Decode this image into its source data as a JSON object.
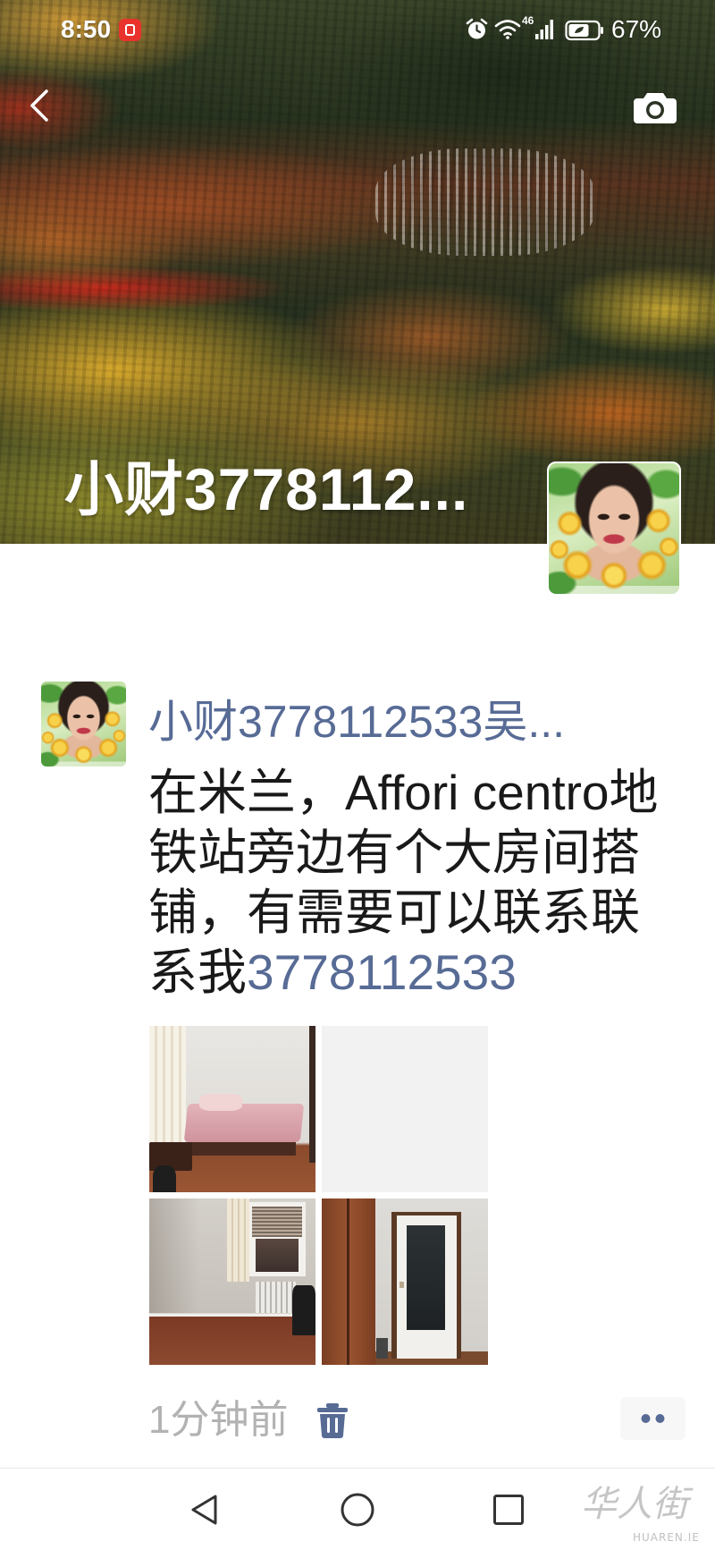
{
  "status_bar": {
    "time": "8:50",
    "network_type": "46",
    "battery": "67%"
  },
  "cover": {
    "name": "小财3778112..."
  },
  "post": {
    "author": "小财3778112533吴...",
    "text": "在米兰，Affori centro地铁站旁边有个大房间搭铺，有需要可以联系联系我",
    "phone": "3778112533",
    "time": "1分钟前"
  },
  "watermark": {
    "logo": "华人街",
    "site": "HUAREN.IE"
  },
  "icons": {
    "back": "chevron-left-icon",
    "camera": "camera-icon",
    "notification": "notification-badge-icon",
    "alarm": "alarm-icon",
    "wifi": "wifi-icon",
    "signal": "signal-icon",
    "battery": "battery-icon",
    "delete": "trash-icon",
    "more": "more-dots-icon",
    "nav_back": "triangle-back-icon",
    "nav_home": "circle-home-icon",
    "nav_recents": "square-recents-icon"
  },
  "colors": {
    "link": "#576b95",
    "text": "#191919",
    "muted": "#b2b2b2",
    "button_bg": "#f7f7f7",
    "badge": "#e8322b"
  }
}
